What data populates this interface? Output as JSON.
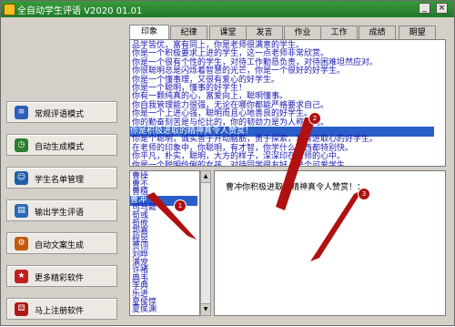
{
  "window": {
    "title": "全自动学生评语 V2020 01.01",
    "minimize": "_",
    "close": "×"
  },
  "sidebar": [
    {
      "label": "常规评语模式",
      "icon": "doc-icon"
    },
    {
      "label": "自动生成模式",
      "icon": "clock-icon"
    },
    {
      "label": "学生名单管理",
      "icon": "users-icon"
    },
    {
      "label": "输出学生评语",
      "icon": "print-icon"
    },
    {
      "label": "自动文案生成",
      "icon": "gear-icon"
    },
    {
      "label": "更多精彩软件",
      "icon": "star-icon"
    },
    {
      "label": "马上注册软件",
      "icon": "dice-icon"
    }
  ],
  "tabs": [
    "印象",
    "纪律",
    "课堂",
    "发言",
    "作业",
    "工作",
    "成绩",
    "期望"
  ],
  "phrases": [
    "品学皆优，富有同上，你是老师很满意的学生。",
    "你是一个积极要求上进的学生，这一点老师非常欣赏。",
    "你是一个很有个性的学生，对待工作勤恳负责，对待困难坦然应对。",
    "你很聪明总是闪烁着智慧的光芒，你是一个很好的好学生。",
    "你是一个懂事理，又很有爱心的好学生。",
    "你是一个聪明，懂事的好学生！",
    "你有一颗纯真的心，富爱向上，聪明懂事。",
    "你自我管理能力很强，无论在哪你都能严格要求自己。",
    "你是一个上进心强，聪明而且心地善良的好学生。",
    "你的勤奋刻苦是与伦比的，你的韧劲力是为人称颂的。",
    "你是积极进取的精神真令人赞赏！",
    "你是个聪明，诚实善于开动脑筋，勇于探索，富有进取心的好学生。",
    "在老师的印象中，你聪明，有才智，你学什么东西都特别快。",
    "你平凡，朴实，聪明，大方的样子，深深印在老师的心中。",
    "你是一个聪明伶俐的女孩，对待同学很友好，是个可爱学生。"
  ],
  "selected_phrase_index": 10,
  "students": [
    "曹操",
    "曹丕",
    "曹植",
    "曹冲",
    "司马懿",
    "荀彧",
    "荀攸",
    "郭嘉",
    "程昱",
    "贾诩",
    "刘晔",
    "满宠",
    "许褚",
    "典韦",
    "李典",
    "乐进",
    "夏侯惇",
    "夏侯渊"
  ],
  "selected_student_index": 3,
  "comment": "曹冲你积极进取的精神真令人赞赏！：",
  "markers": [
    "1",
    "2",
    "3"
  ],
  "colors": {
    "accent": "#2a5ec8",
    "text_blue": "#1818b0",
    "marker": "#b01010"
  }
}
